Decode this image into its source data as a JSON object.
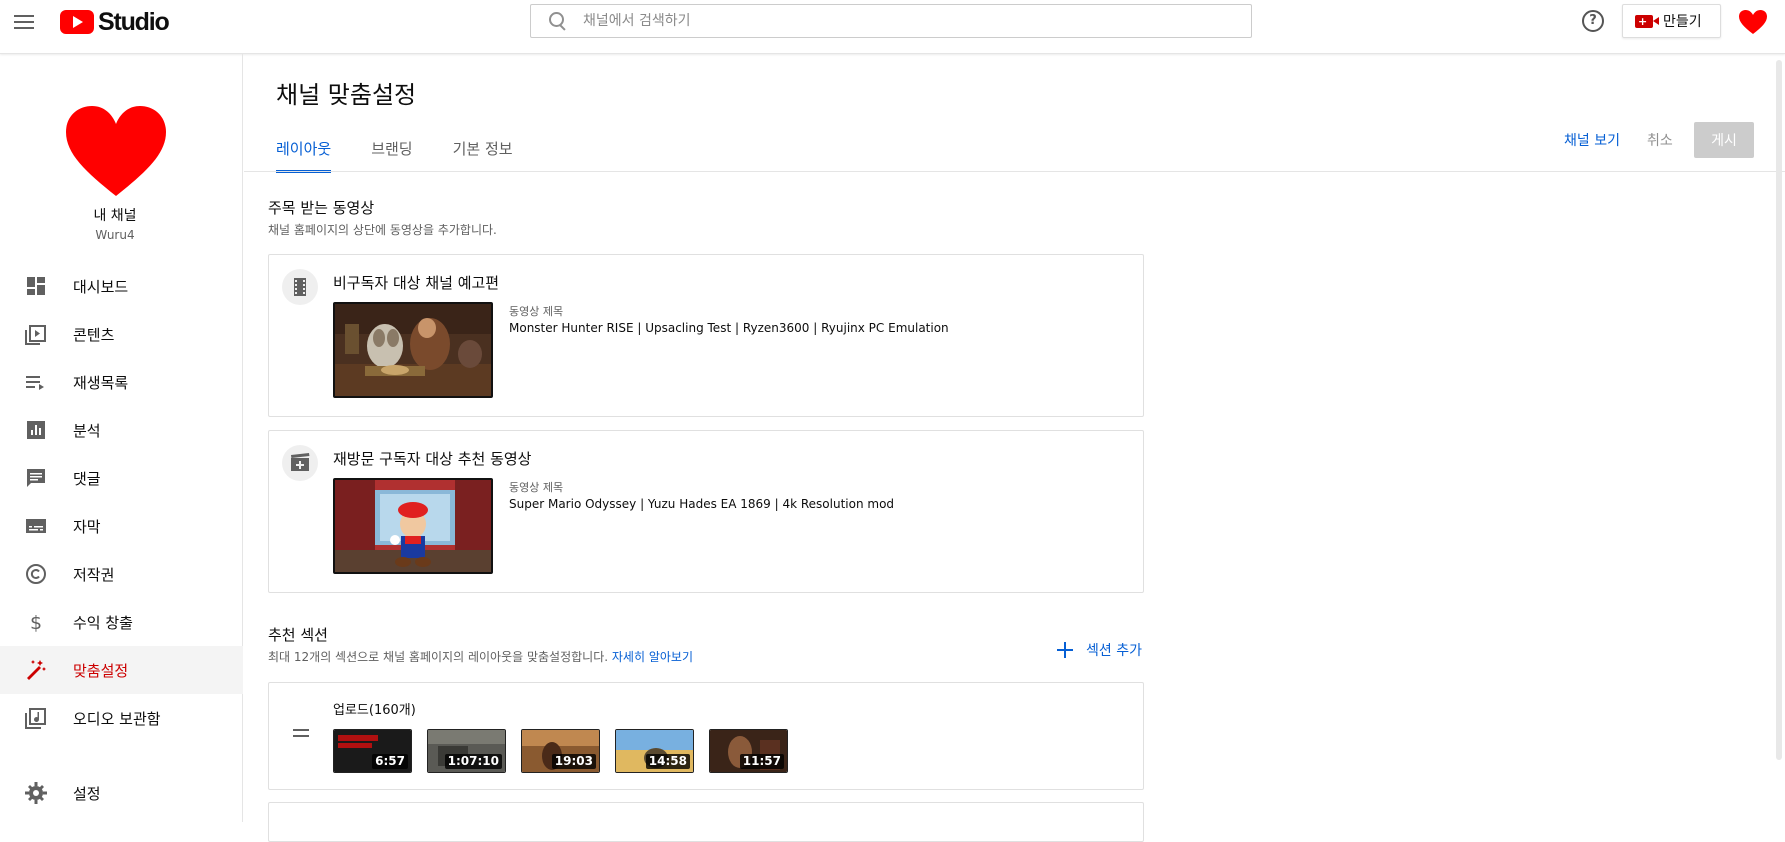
{
  "header": {
    "logo_text": "Studio",
    "search_placeholder": "채널에서 검색하기",
    "help_glyph": "?",
    "create_label": "만들기"
  },
  "sidebar": {
    "channel_title": "내 채널",
    "channel_handle": "Wuru4",
    "items": [
      {
        "label": "대시보드",
        "icon": "dashboard-icon"
      },
      {
        "label": "콘텐츠",
        "icon": "content-icon"
      },
      {
        "label": "재생목록",
        "icon": "playlist-icon"
      },
      {
        "label": "분석",
        "icon": "analytics-icon"
      },
      {
        "label": "댓글",
        "icon": "comments-icon"
      },
      {
        "label": "자막",
        "icon": "subtitles-icon"
      },
      {
        "label": "저작권",
        "icon": "copyright-icon"
      },
      {
        "label": "수익 창출",
        "icon": "monetization-icon"
      },
      {
        "label": "맞춤설정",
        "icon": "customization-icon",
        "active": true
      },
      {
        "label": "오디오 보관함",
        "icon": "audio-library-icon"
      }
    ],
    "settings_label": "설정"
  },
  "main": {
    "page_title": "채널 맞춤설정",
    "tabs": [
      {
        "label": "레이아웃",
        "active": true
      },
      {
        "label": "브랜딩"
      },
      {
        "label": "기본 정보"
      }
    ],
    "view_channel": "채널 보기",
    "cancel": "취소",
    "publish": "게시",
    "featured": {
      "title": "주목 받는 동영상",
      "desc": "채널 홈페이지의 상단에 동영상을 추가합니다.",
      "cards": [
        {
          "title": "비구독자 대상 채널 예고편",
          "icon": "film-icon",
          "meta_label": "동영상 제목",
          "video_title": "Monster Hunter RISE | Upsacling Test | Ryzen3600 | Ryujinx PC Emulation"
        },
        {
          "title": "재방문 구독자 대상 추천 동영상",
          "icon": "video-add-icon",
          "meta_label": "동영상 제목",
          "video_title": "Super Mario Odyssey | Yuzu Hades EA 1869 | 4k Resolution mod"
        }
      ]
    },
    "sections": {
      "title": "추천 섹션",
      "desc": "최대 12개의 섹션으로 채널 홈페이지의 레이아웃을 맞춤설정합니다.",
      "learn_more": "자세히 알아보기",
      "add_section": "섹션 추가",
      "uploads_title": "업로드(160개)",
      "uploads": [
        {
          "duration": "6:57"
        },
        {
          "duration": "1:07:10"
        },
        {
          "duration": "19:03"
        },
        {
          "duration": "14:58"
        },
        {
          "duration": "11:57"
        }
      ]
    }
  },
  "colors": {
    "brand_red": "#ff0000",
    "active_red": "#cc0000",
    "link_blue": "#065fd4"
  }
}
